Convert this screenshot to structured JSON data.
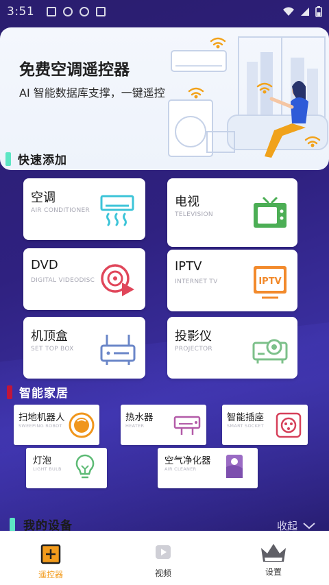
{
  "status_bar": {
    "time": "3:51"
  },
  "banner": {
    "title": "免费空调遥控器",
    "subtitle": "AI 智能数据库支撑，一键遥控"
  },
  "quick_add": {
    "title": "快速添加",
    "accent": "#5de6c4",
    "items": [
      {
        "zh": "空调",
        "en": "AIR CONDITIONER",
        "icon": "air-conditioner-icon"
      },
      {
        "zh": "电视",
        "en": "TELEVISION",
        "icon": "tv-icon"
      },
      {
        "zh": "DVD",
        "en": "DIGITAL VIDEODISC",
        "icon": "dvd-icon"
      },
      {
        "zh": "IPTV",
        "en": "INTERNET TV",
        "icon": "iptv-icon"
      },
      {
        "zh": "机顶盒",
        "en": "SET TOP BOX",
        "icon": "set-top-box-icon"
      },
      {
        "zh": "投影仪",
        "en": "PROJECTOR",
        "icon": "projector-icon"
      }
    ]
  },
  "smart_home": {
    "title": "智能家居",
    "accent": "#c0163a",
    "items": [
      {
        "zh": "扫地机器人",
        "en": "SWEEPING ROBOT",
        "icon": "robot-vacuum-icon"
      },
      {
        "zh": "热水器",
        "en": "HEATER",
        "icon": "water-heater-icon"
      },
      {
        "zh": "智能插座",
        "en": "SMART SOCKET",
        "icon": "smart-socket-icon"
      },
      {
        "zh": "灯泡",
        "en": "LIGHT BULB",
        "icon": "light-bulb-icon"
      },
      {
        "zh": "空气净化器",
        "en": "AIR CLEANER",
        "icon": "air-cleaner-icon"
      }
    ]
  },
  "my_devices": {
    "title": "我的设备",
    "collapse_label": "收起"
  },
  "bottom_nav": {
    "items": [
      {
        "label": "遥控器",
        "icon": "remote-icon",
        "active": true
      },
      {
        "label": "视频",
        "icon": "video-icon",
        "active": false
      },
      {
        "label": "设置",
        "icon": "settings-icon",
        "active": false
      }
    ],
    "active_color": "#f29b1c"
  }
}
